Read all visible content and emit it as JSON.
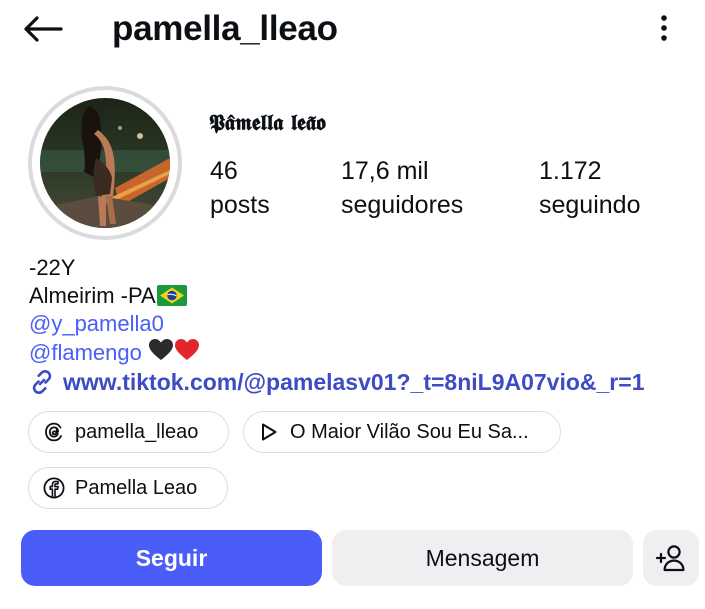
{
  "header": {
    "username": "pamella_lleao",
    "back_icon": "arrow-left-icon",
    "more_icon": "more-vertical-icon"
  },
  "profile": {
    "display_name": "𝕻𝖆̂𝖒𝖊𝖑𝖑𝖆 𝖑𝖊𝖆̃𝖔",
    "stats": {
      "posts_count": "46",
      "posts_label": "posts",
      "followers_count": "17,6 mil",
      "followers_label": "seguidores",
      "following_count": "1.172",
      "following_label": "seguindo"
    }
  },
  "bio": {
    "line1": "-22Y",
    "line2": "Almeirim -PA",
    "line2_emoji": "brazil-flag",
    "mention1": "@y_pamella0",
    "mention2": "@flamengo",
    "mention2_emojis": [
      "black-heart",
      "red-heart"
    ],
    "link": "www.tiktok.com/@pamelasv01?_t=8niL9A07vio&_r=1"
  },
  "chips": {
    "threads_label": "pamella_lleao",
    "music_label": "O Maior Vilão Sou Eu Sa...",
    "facebook_label": "Pamella Leao"
  },
  "actions": {
    "follow_label": "Seguir",
    "message_label": "Mensagem",
    "add_user_icon": "add-person-icon"
  },
  "colors": {
    "accent": "#4a5df9",
    "link": "#3e4cc4",
    "button_bg": "#efeff1",
    "text": "#0c1014",
    "chip_border": "#dbdfe4"
  }
}
